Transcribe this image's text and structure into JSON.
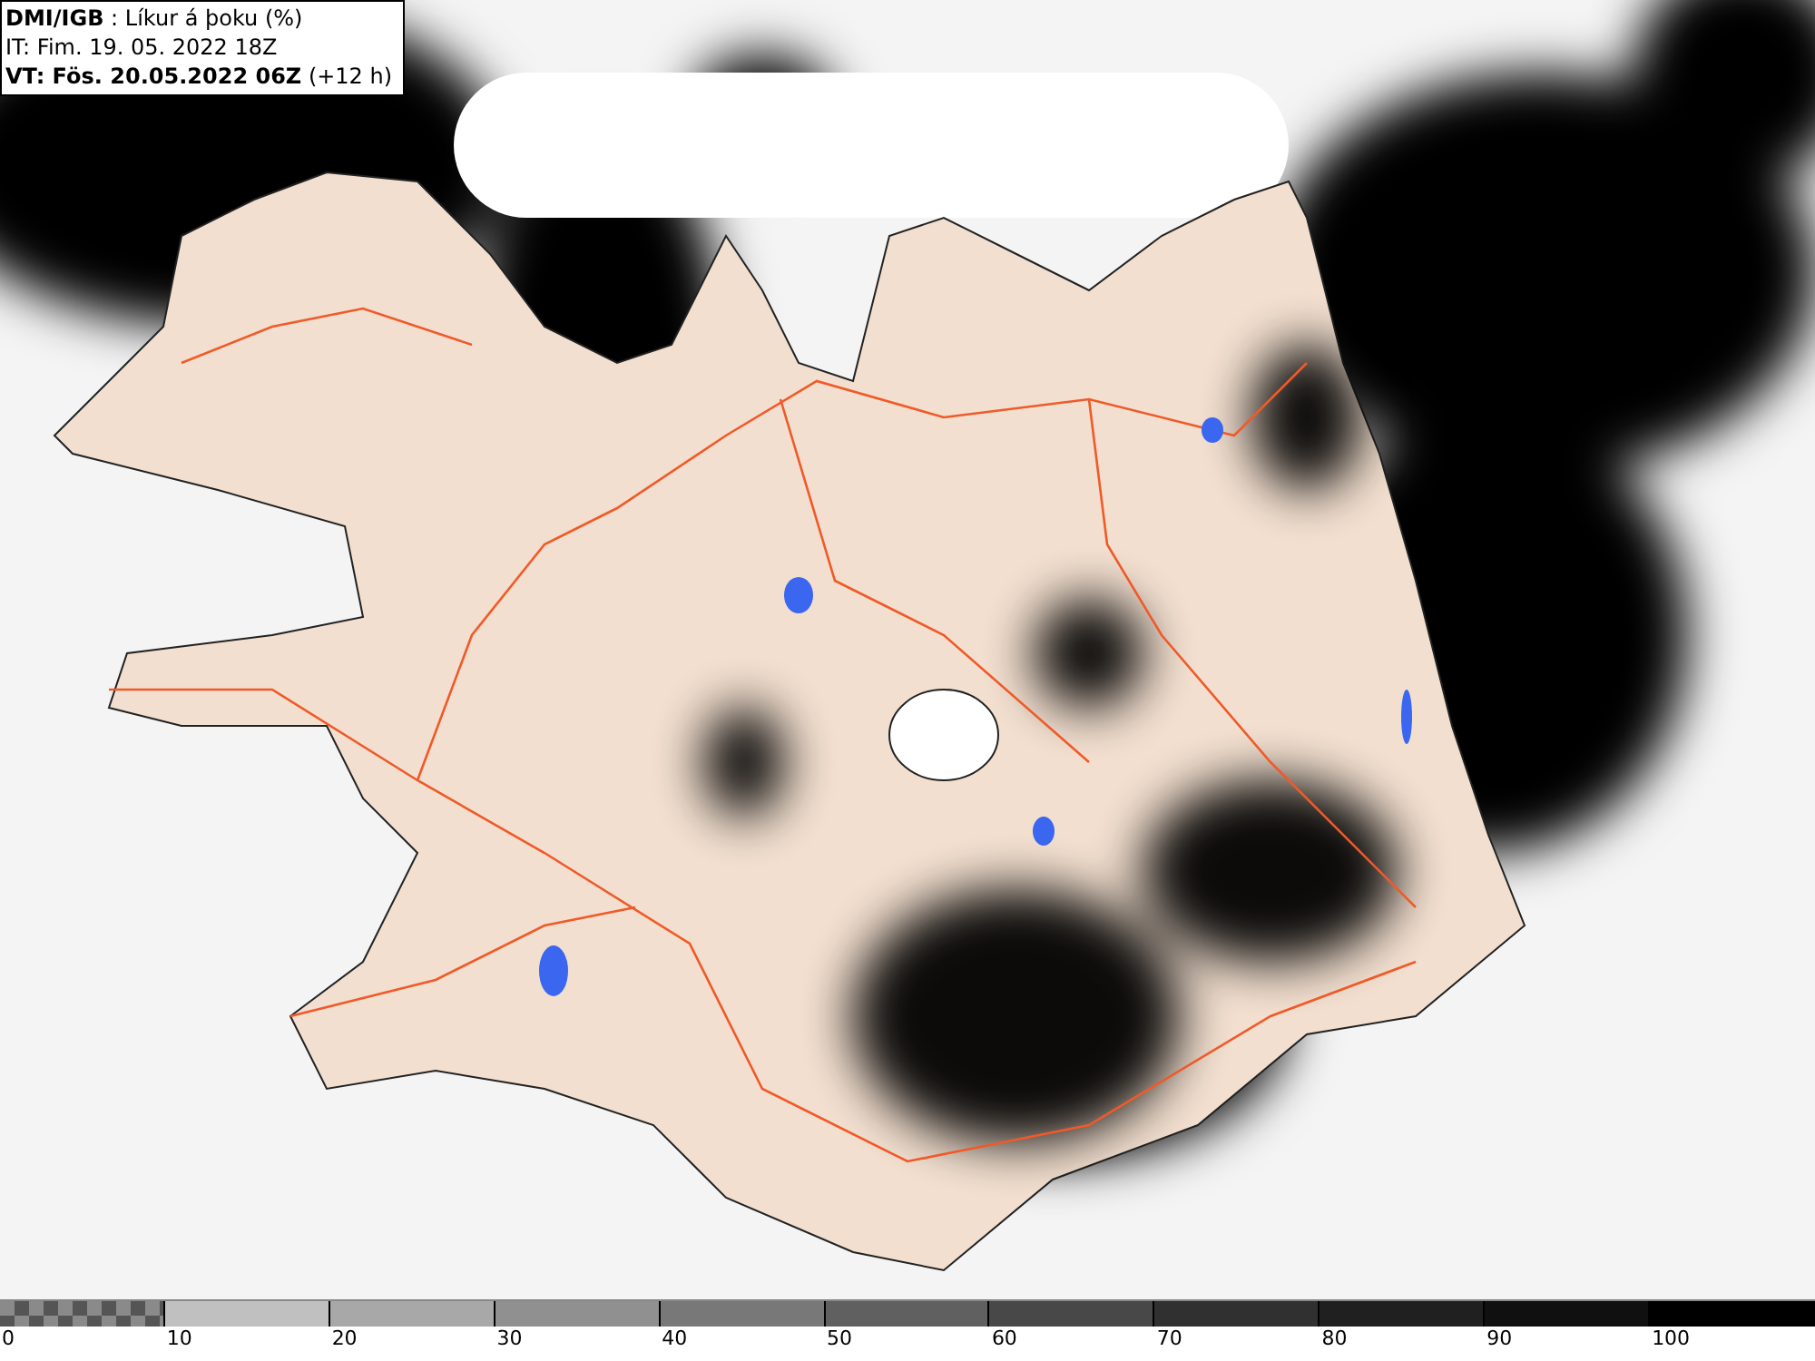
{
  "header": {
    "lines": [
      "**DMI/IGB** : Líkur á þoku (%)",
      "IT: Fim. 19. 05. 2022 18Z",
      "**VT: Fös. 20.05.2022 06Z** (+12 h)"
    ]
  },
  "legend": [
    {
      "label": "0",
      "kind": "checker",
      "color": "#555555"
    },
    {
      "label": "10",
      "kind": "solid",
      "color": "#c0c0c0"
    },
    {
      "label": "20",
      "kind": "solid",
      "color": "#a8a8a8"
    },
    {
      "label": "30",
      "kind": "solid",
      "color": "#909090"
    },
    {
      "label": "40",
      "kind": "solid",
      "color": "#787878"
    },
    {
      "label": "50",
      "kind": "solid",
      "color": "#606060"
    },
    {
      "label": "60",
      "kind": "solid",
      "color": "#484848"
    },
    {
      "label": "70",
      "kind": "solid",
      "color": "#303030"
    },
    {
      "label": "80",
      "kind": "solid",
      "color": "#202020"
    },
    {
      "label": "90",
      "kind": "solid",
      "color": "#101010"
    },
    {
      "label": "100",
      "kind": "solid",
      "color": "#000000"
    }
  ]
}
